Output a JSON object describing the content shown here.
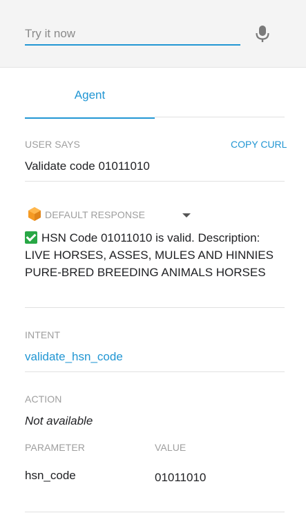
{
  "tryit": {
    "placeholder": "Try it now",
    "mic_icon": "microphone-icon"
  },
  "tabs": [
    {
      "label": "Agent",
      "active": true
    }
  ],
  "user_says": {
    "label": "USER SAYS",
    "copy_curl": "COPY CURL",
    "value": "Validate code 01011010"
  },
  "response": {
    "icon": "hexagon-icon",
    "label": "DEFAULT RESPONSE",
    "check_icon": "check-mark-icon",
    "text_lines": [
      "HSN Code 01011010 is valid. Description:",
      "LIVE HORSES, ASSES, MULES AND HINNIES",
      "PURE-BRED BREEDING ANIMALS HORSES"
    ]
  },
  "intent": {
    "label": "INTENT",
    "value": "validate_hsn_code"
  },
  "action": {
    "label": "ACTION",
    "value": "Not available"
  },
  "parameters": {
    "header_parameter": "PARAMETER",
    "header_value": "VALUE",
    "rows": [
      {
        "name": "hsn_code",
        "value": "01011010"
      }
    ]
  },
  "colors": {
    "accent": "#2196d3",
    "check": "#28a745",
    "hex": "#f59a23"
  }
}
